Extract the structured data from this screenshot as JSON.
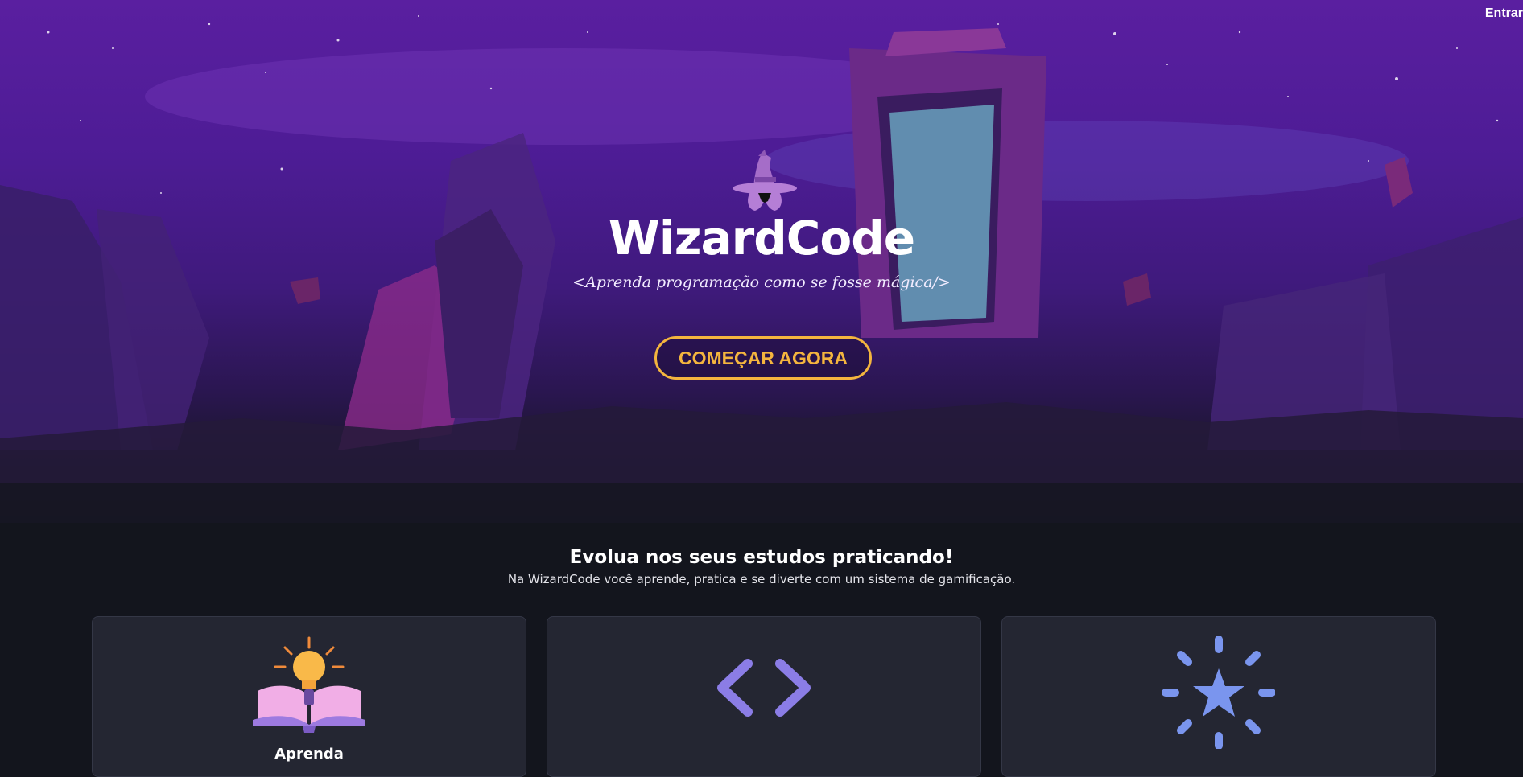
{
  "header": {
    "login_label": "Entrar"
  },
  "hero": {
    "brand": "WizardCode",
    "tagline": "<Aprenda programação como se fosse mágica/>",
    "cta_label": "COMEÇAR AGORA"
  },
  "section": {
    "title": "Evolua nos seus estudos praticando!",
    "subtitle": "Na WizardCode você aprende, pratica e se diverte com um sistema de gamificação."
  },
  "cards": [
    {
      "title": "Aprenda",
      "icon": "book-lightbulb-icon"
    },
    {
      "title": "",
      "icon": "code-brackets-icon"
    },
    {
      "title": "",
      "icon": "star-burst-icon"
    }
  ],
  "colors": {
    "accent": "#f4b53e",
    "hero_top": "#5a1fa0",
    "card_bg": "#242632",
    "page_bg": "#13151d"
  }
}
